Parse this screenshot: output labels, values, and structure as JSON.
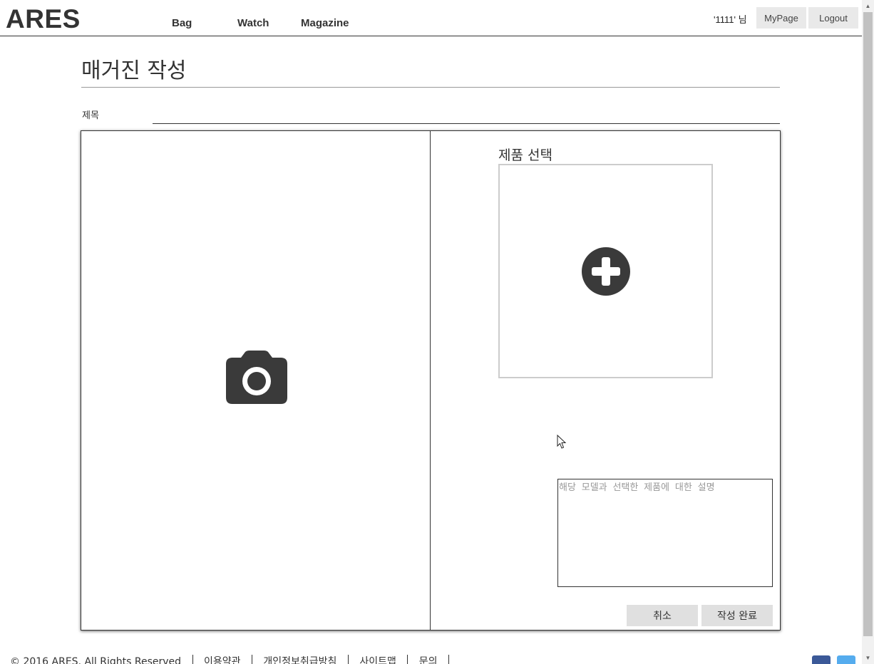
{
  "header": {
    "logo": "ARES",
    "nav": [
      "Bag",
      "Watch",
      "Magazine"
    ],
    "user_greeting": "'1111' 님",
    "mypage_label": "MyPage",
    "logout_label": "Logout"
  },
  "page": {
    "title": "매거진 작성",
    "subject_label": "제목",
    "subject_value": ""
  },
  "editor": {
    "image_upload_icon": "camera-icon",
    "product_label": "제품 선택",
    "add_product_icon": "plus-circle-icon",
    "description_placeholder": "해당 모델과 선택한 제품에 대한 설명",
    "cancel_label": "취소",
    "submit_label": "작성 완료"
  },
  "footer": {
    "copyright": "© 2016 ARES. All Rights Reserved",
    "links": [
      "이용약관",
      "개인정보취급방침",
      "사이트맵",
      "문의"
    ],
    "social_icons": [
      "facebook-icon",
      "twitter-icon"
    ]
  },
  "colors": {
    "text": "#333333",
    "button_bg": "#e0e0e0",
    "header_button_bg": "#e9e9e9",
    "icon_dark": "#3a3a3a",
    "facebook": "#3b5998",
    "twitter": "#55acee"
  }
}
